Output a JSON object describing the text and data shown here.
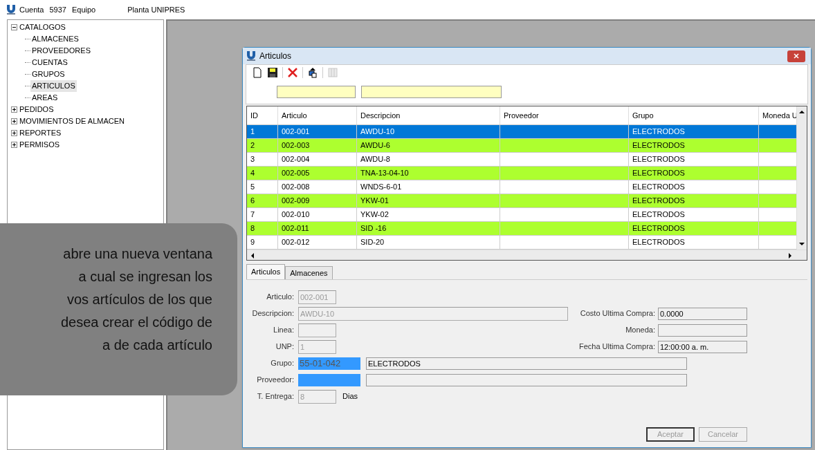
{
  "topbar": {
    "account_label": "Cuenta",
    "account_number": "5937",
    "team_label": "Equipo",
    "plant": "Planta UNIPRES"
  },
  "tree": [
    {
      "label": "CATALOGOS",
      "expanded": true,
      "selected": false,
      "children": [
        {
          "label": "ALMACENES",
          "selected": false
        },
        {
          "label": "PROVEEDORES",
          "selected": false
        },
        {
          "label": "CUENTAS",
          "selected": false
        },
        {
          "label": "GRUPOS",
          "selected": false
        },
        {
          "label": "ARTICULOS",
          "selected": true
        },
        {
          "label": "AREAS",
          "selected": false
        }
      ]
    },
    {
      "label": "PEDIDOS",
      "expanded": false,
      "selected": false
    },
    {
      "label": "MOVIMIENTOS DE ALMACEN",
      "expanded": false,
      "selected": false
    },
    {
      "label": "REPORTES",
      "expanded": false,
      "selected": false
    },
    {
      "label": "PERMISOS",
      "expanded": false,
      "selected": false
    }
  ],
  "callout": {
    "lines": [
      "abre una nueva ventana",
      "a cual se ingresan los",
      "vos artículos de los que",
      "desea crear el código de",
      "a de cada artículo"
    ]
  },
  "window": {
    "title": "Articulos",
    "toolbar": [
      {
        "kind": "new",
        "disabled": false
      },
      {
        "kind": "save",
        "disabled": false
      },
      {
        "kind": "delete",
        "disabled": false
      },
      {
        "kind": "import",
        "disabled": false
      },
      {
        "kind": "grid",
        "disabled": true
      }
    ],
    "filters": [
      {
        "kind": "code"
      },
      {
        "kind": "description"
      }
    ],
    "table": {
      "columns": [
        "ID",
        "Articulo",
        "Descripcion",
        "Proveedor",
        "Grupo",
        "Moneda U"
      ],
      "rows": [
        {
          "cells": [
            "1",
            "002-001",
            "AWDU-10",
            "",
            "ELECTRODOS",
            ""
          ],
          "selected": true,
          "color": "#0078d7"
        },
        {
          "cells": [
            "2",
            "002-003",
            "AWDU-6",
            "",
            "ELECTRODOS",
            ""
          ],
          "selected": false,
          "color": "#adff2f"
        },
        {
          "cells": [
            "3",
            "002-004",
            "AWDU-8",
            "",
            "ELECTRODOS",
            ""
          ],
          "selected": false,
          "color": "#ffffff"
        },
        {
          "cells": [
            "4",
            "002-005",
            "TNA-13-04-10",
            "",
            "ELECTRODOS",
            ""
          ],
          "selected": false,
          "color": "#adff2f"
        },
        {
          "cells": [
            "5",
            "002-008",
            "WNDS-6-01",
            "",
            "ELECTRODOS",
            ""
          ],
          "selected": false,
          "color": "#ffffff"
        },
        {
          "cells": [
            "6",
            "002-009",
            "YKW-01",
            "",
            "ELECTRODOS",
            ""
          ],
          "selected": false,
          "color": "#adff2f"
        },
        {
          "cells": [
            "7",
            "002-010",
            "YKW-02",
            "",
            "ELECTRODOS",
            ""
          ],
          "selected": false,
          "color": "#ffffff"
        },
        {
          "cells": [
            "8",
            "002-011",
            "SID -16",
            "",
            "ELECTRODOS",
            ""
          ],
          "selected": false,
          "color": "#adff2f"
        },
        {
          "cells": [
            "9",
            "002-012",
            "SID-20",
            "",
            "ELECTRODOS",
            ""
          ],
          "selected": false,
          "color": "#ffffff"
        }
      ]
    },
    "tabs": [
      {
        "label": "Articulos",
        "selected": true
      },
      {
        "label": "Almacenes",
        "selected": false
      }
    ],
    "form_left": [
      {
        "label": "Articulo:",
        "value": "002-001",
        "kind": "short"
      },
      {
        "label": "Descripcion:",
        "value": "AWDU-10",
        "kind": "long"
      },
      {
        "label": "Linea:",
        "kind": "short"
      },
      {
        "label": "UNP:",
        "value": "1",
        "kind": "short"
      },
      {
        "label": "Grupo:",
        "value": "55-01-042",
        "value2": "ELECTRODOS",
        "kind": "lookup"
      },
      {
        "label": "Proveedor:",
        "kind": "lookup"
      },
      {
        "label": "T. Entrega:",
        "value": "8",
        "unit": "Dias",
        "kind": "unit"
      }
    ],
    "form_right": [
      {
        "label": "Costo Ultima Compra:",
        "value": "0.0000"
      },
      {
        "label": "Moneda:"
      },
      {
        "label": "Fecha Ultima Compra:",
        "value": "12:00:00 a. m."
      }
    ],
    "buttons": [
      {
        "label": "Aceptar",
        "disabled": true,
        "default": true
      },
      {
        "label": "Cancelar",
        "disabled": true,
        "default": false
      }
    ]
  }
}
